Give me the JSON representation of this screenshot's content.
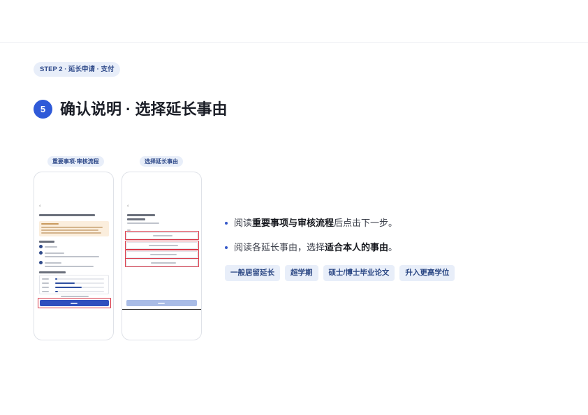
{
  "step_label": "STEP 2 · 延长申请 · 支付",
  "section": {
    "number": "5",
    "title": "确认说明 · 选择延长事由"
  },
  "phones": [
    {
      "label": "重要事项·审核流程"
    },
    {
      "label": "选择延长事由"
    }
  ],
  "bullets": [
    {
      "pre": "阅读 ",
      "bold": "重要事项与审核流程",
      "post": " 后点击下一步。"
    },
    {
      "pre": "阅读各延长事由，选择 ",
      "bold": "适合本人的事由",
      "post": "。"
    }
  ],
  "tags": [
    "一般居留延长",
    "超学期",
    "硕士/博士毕业论文",
    "升入更高学位"
  ],
  "colors": {
    "accent": "#2f5ad8",
    "pill_bg": "#e8eef9",
    "highlight": "#d93848",
    "notice_bg": "#fbeedd"
  }
}
